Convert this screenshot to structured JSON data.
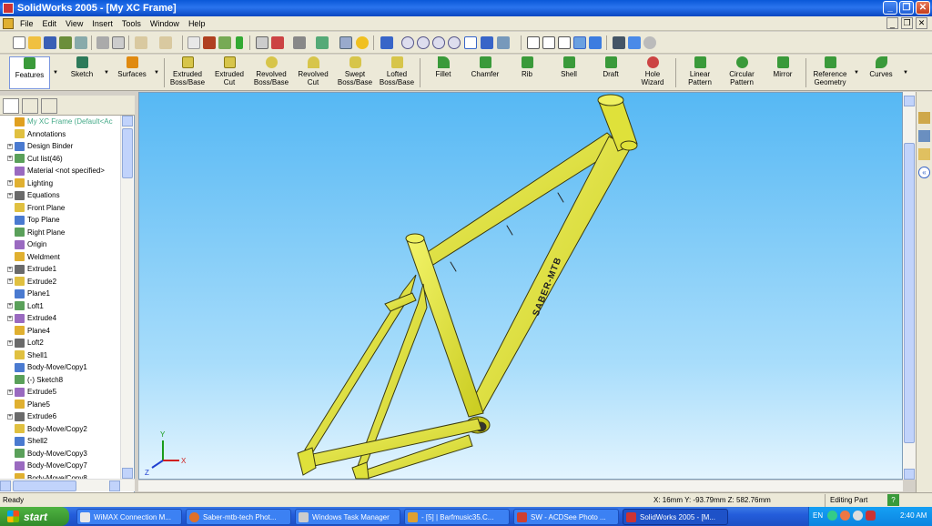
{
  "window": {
    "title": "SolidWorks 2005 - [My XC Frame]",
    "min_glyph": "_",
    "max_glyph": "❐",
    "close_glyph": "✕"
  },
  "menu": {
    "items": [
      "File",
      "Edit",
      "View",
      "Insert",
      "Tools",
      "Window",
      "Help"
    ]
  },
  "command_manager": {
    "groups": [
      {
        "label": "Features"
      },
      {
        "label": "Sketch"
      },
      {
        "label": "Surfaces"
      }
    ],
    "commands": [
      {
        "label": "Extruded Boss/Base"
      },
      {
        "label": "Extruded Cut"
      },
      {
        "label": "Revolved Boss/Base"
      },
      {
        "label": "Revolved Cut"
      },
      {
        "label": "Swept Boss/Base"
      },
      {
        "label": "Lofted Boss/Base"
      },
      {
        "label": "Fillet"
      },
      {
        "label": "Chamfer"
      },
      {
        "label": "Rib"
      },
      {
        "label": "Shell"
      },
      {
        "label": "Draft"
      },
      {
        "label": "Hole Wizard"
      },
      {
        "label": "Linear Pattern"
      },
      {
        "label": "Circular Pattern"
      },
      {
        "label": "Mirror"
      },
      {
        "label": "Reference Geometry"
      },
      {
        "label": "Curves"
      }
    ]
  },
  "feature_tree": {
    "root": "My XC Frame  (Default<Ac",
    "items": [
      {
        "label": "Annotations",
        "expandable": false
      },
      {
        "label": "Design Binder",
        "expandable": true
      },
      {
        "label": "Cut list(46)",
        "expandable": true
      },
      {
        "label": "Material <not specified>",
        "expandable": false
      },
      {
        "label": "Lighting",
        "expandable": true
      },
      {
        "label": "Equations",
        "expandable": true
      },
      {
        "label": "Front Plane",
        "expandable": false
      },
      {
        "label": "Top Plane",
        "expandable": false
      },
      {
        "label": "Right Plane",
        "expandable": false
      },
      {
        "label": "Origin",
        "expandable": false
      },
      {
        "label": "Weldment",
        "expandable": false
      },
      {
        "label": "Extrude1",
        "expandable": true
      },
      {
        "label": "Extrude2",
        "expandable": true
      },
      {
        "label": "Plane1",
        "expandable": false
      },
      {
        "label": "Loft1",
        "expandable": true
      },
      {
        "label": "Extrude4",
        "expandable": true
      },
      {
        "label": "Plane4",
        "expandable": false
      },
      {
        "label": "Loft2",
        "expandable": true
      },
      {
        "label": "Shell1",
        "expandable": false
      },
      {
        "label": "Body-Move/Copy1",
        "expandable": false
      },
      {
        "label": "(-) Sketch8",
        "expandable": false
      },
      {
        "label": "Extrude5",
        "expandable": true
      },
      {
        "label": "Plane5",
        "expandable": false
      },
      {
        "label": "Extrude6",
        "expandable": true
      },
      {
        "label": "Body-Move/Copy2",
        "expandable": false
      },
      {
        "label": "Shell2",
        "expandable": false
      },
      {
        "label": "Body-Move/Copy3",
        "expandable": false
      },
      {
        "label": "Body-Move/Copy7",
        "expandable": false
      },
      {
        "label": "Body-Move/Copy8",
        "expandable": false
      }
    ]
  },
  "viewport": {
    "frame_decal": "SABER-MTB",
    "triad": {
      "x": "X",
      "y": "Y",
      "z": "Z"
    }
  },
  "status": {
    "left": "Ready",
    "coords": "X: 16mm  Y: -93.79mm  Z: 582.76mm",
    "mode": "Editing Part",
    "help": "?"
  },
  "taskbar": {
    "start": "start",
    "tasks": [
      {
        "label": "WiMAX Connection M..."
      },
      {
        "label": "Saber-mtb-tech Phot..."
      },
      {
        "label": "Windows Task Manager"
      },
      {
        "label": "- [5] | Barfmusic35.C..."
      },
      {
        "label": "SW - ACDSee Photo ..."
      },
      {
        "label": "SolidWorks 2005 - [M..."
      }
    ],
    "tray": {
      "lang": "EN",
      "time": "2:40 AM"
    }
  },
  "colors": {
    "frame": "#e3e532",
    "frame_shade": "#a7a914",
    "viewport_top": "#56b8f4",
    "title_bar": "#0a58d8"
  }
}
